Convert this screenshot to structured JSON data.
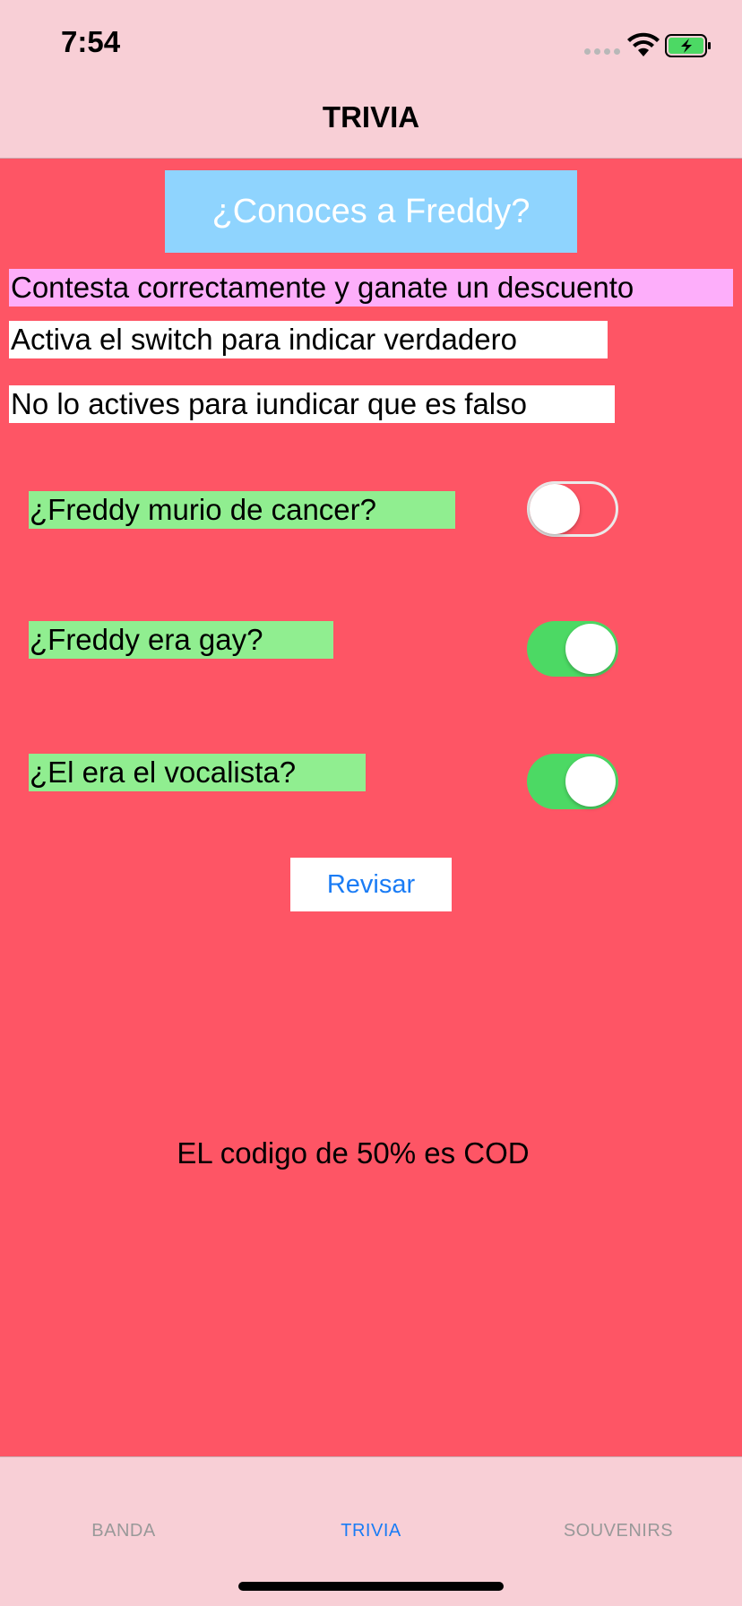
{
  "status_bar": {
    "time": "7:54",
    "battery_color": "#4cd964"
  },
  "nav": {
    "title": "TRIVIA"
  },
  "content": {
    "background": "#fe5565",
    "header": "¿Conoces a Freddy?",
    "instructions": [
      "Contesta correctamente y ganate un descuento",
      "Activa el switch para indicar verdadero",
      "No lo actives para iundicar que es falso"
    ],
    "questions": [
      {
        "text": "¿Freddy murio de cancer?",
        "switch_on": false
      },
      {
        "text": "¿Freddy era gay?",
        "switch_on": true
      },
      {
        "text": "¿El era el vocalista?",
        "switch_on": true
      }
    ],
    "review_button": "Revisar",
    "result": "EL codigo de 50% es COD"
  },
  "tabbar": {
    "tabs": [
      {
        "label": "BANDA",
        "active": false
      },
      {
        "label": "TRIVIA",
        "active": true
      },
      {
        "label": "SOUVENIRS",
        "active": false
      }
    ],
    "active_color": "#1a7cf5"
  }
}
